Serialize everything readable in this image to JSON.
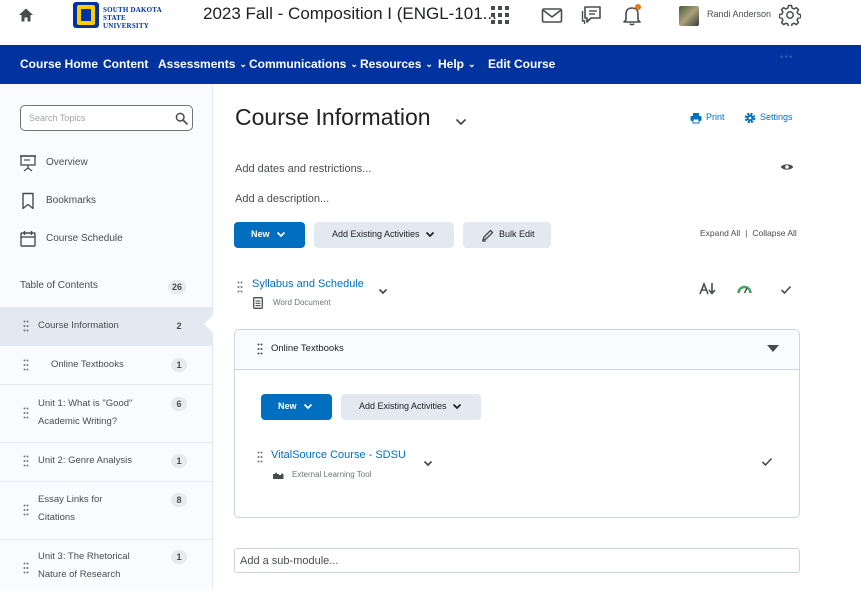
{
  "topbar": {
    "logo_line1": "SOUTH DAKOTA",
    "logo_line2": "STATE UNIVERSITY",
    "course_title": "2023 Fall - Composition I (ENGL-101...",
    "user_name": "Randi Anderson",
    "icons": [
      "home-icon",
      "waffle-icon",
      "mail-icon",
      "chat-icon",
      "bell-icon",
      "gear-icon"
    ],
    "notification_color": "#e87511"
  },
  "nav": {
    "items": [
      {
        "label": "Course Home",
        "dropdown": false
      },
      {
        "label": "Content",
        "dropdown": false
      },
      {
        "label": "Assessments",
        "dropdown": true
      },
      {
        "label": "Communications",
        "dropdown": true
      },
      {
        "label": "Resources",
        "dropdown": true
      },
      {
        "label": "Help",
        "dropdown": true
      },
      {
        "label": "Edit Course",
        "dropdown": false
      }
    ],
    "bg_color": "#0033a0"
  },
  "sidebar": {
    "search_placeholder": "Search Topics",
    "links": [
      {
        "label": "Overview",
        "icon": "overview-icon"
      },
      {
        "label": "Bookmarks",
        "icon": "bookmark-icon"
      },
      {
        "label": "Course Schedule",
        "icon": "calendar-icon"
      }
    ],
    "toc_label": "Table of Contents",
    "toc_count": "26",
    "toc_items": [
      {
        "label": "Course Information",
        "count": "2",
        "selected": true
      },
      {
        "label": "Online Textbooks",
        "count": "1",
        "selected": false
      },
      {
        "label": "Unit 1: What is \"Good\" Academic Writing?",
        "count": "6",
        "selected": false
      },
      {
        "label": "Unit 2: Genre Analysis",
        "count": "1",
        "selected": false
      },
      {
        "label": "Essay Links for Citations",
        "count": "8",
        "selected": false
      },
      {
        "label": "Unit 3: The Rhetorical Nature of Research",
        "count": "1",
        "selected": false
      }
    ]
  },
  "main": {
    "title": "Course Information",
    "print_label": "Print",
    "settings_label": "Settings",
    "dates_link": "Add dates and restrictions...",
    "description_link": "Add a description...",
    "new_button": "New",
    "add_existing_button": "Add Existing Activities",
    "bulk_edit_button": "Bulk Edit",
    "expand_all": "Expand All",
    "collapse_all": "Collapse All",
    "topic": {
      "title": "Syllabus and Schedule",
      "type": "Word Document"
    },
    "module": {
      "title": "Online Textbooks",
      "new_button": "New",
      "add_existing_button": "Add Existing Activities",
      "topic": {
        "title": "VitalSource Course - SDSU",
        "type": "External Learning Tool"
      }
    },
    "submodule_placeholder": "Add a sub-module..."
  }
}
